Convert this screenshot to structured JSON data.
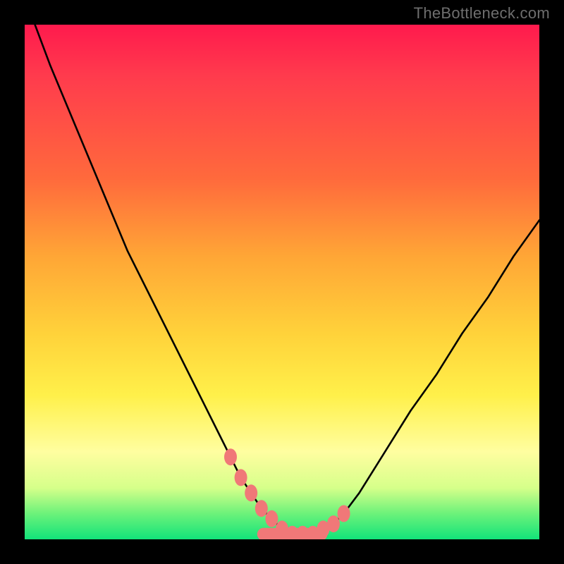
{
  "watermark": "TheBottleneck.com",
  "chart_data": {
    "type": "line",
    "title": "",
    "xlabel": "",
    "ylabel": "",
    "xlim": [
      0,
      100
    ],
    "ylim": [
      0,
      100
    ],
    "x": [
      2,
      5,
      10,
      15,
      20,
      25,
      30,
      35,
      38,
      40,
      42,
      44,
      46,
      48,
      50,
      52,
      54,
      56,
      58,
      60,
      62,
      65,
      70,
      75,
      80,
      85,
      90,
      95,
      100
    ],
    "values": [
      100,
      92,
      80,
      68,
      56,
      46,
      36,
      26,
      20,
      16,
      12,
      9,
      6,
      4,
      2,
      1,
      1,
      1,
      2,
      3,
      5,
      9,
      17,
      25,
      32,
      40,
      47,
      55,
      62
    ],
    "markers": {
      "x": [
        40,
        42,
        44,
        46,
        48,
        50,
        52,
        54,
        56,
        58,
        60,
        62
      ],
      "y": [
        16,
        12,
        9,
        6,
        4,
        2,
        1,
        1,
        1,
        2,
        3,
        5
      ]
    },
    "marker_color": "#f07878",
    "line_color": "#000000",
    "background": "gradient"
  }
}
